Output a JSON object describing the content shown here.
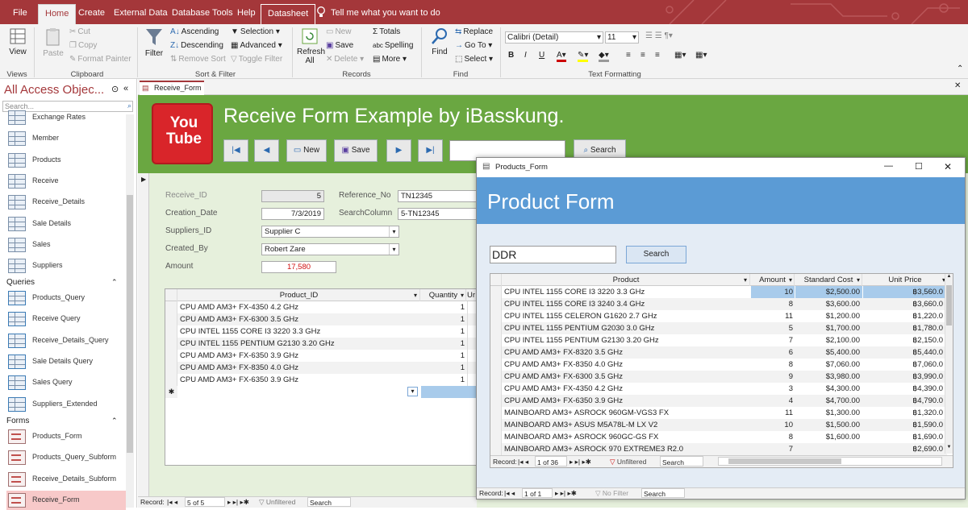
{
  "menubar": {
    "tabs": [
      "File",
      "Home",
      "Create",
      "External Data",
      "Database Tools",
      "Help",
      "Datasheet"
    ],
    "tell_me": "Tell me what you want to do"
  },
  "ribbon": {
    "views": {
      "view": "View",
      "label": "Views"
    },
    "clipboard": {
      "paste": "Paste",
      "cut": "Cut",
      "copy": "Copy",
      "format_painter": "Format Painter",
      "label": "Clipboard"
    },
    "sort_filter": {
      "filter": "Filter",
      "ascending": "Ascending",
      "descending": "Descending",
      "remove_sort": "Remove Sort",
      "selection": "Selection",
      "advanced": "Advanced",
      "toggle_filter": "Toggle Filter",
      "label": "Sort & Filter"
    },
    "records": {
      "refresh": "Refresh",
      "refresh2": "All",
      "new": "New",
      "save": "Save",
      "delete": "Delete",
      "totals": "Totals",
      "spelling": "Spelling",
      "more": "More",
      "label": "Records"
    },
    "find": {
      "find": "Find",
      "replace": "Replace",
      "goto": "Go To",
      "select": "Select",
      "label": "Find"
    },
    "text": {
      "font": "Calibri (Detail)",
      "size": "11",
      "label": "Text Formatting"
    }
  },
  "nav": {
    "title": "All Access Objec...",
    "search_placeholder": "Search...",
    "tables": [
      "Exchange Rates",
      "Member",
      "Products",
      "Receive",
      "Receive_Details",
      "Sale Details",
      "Sales",
      "Suppliers"
    ],
    "queries_header": "Queries",
    "queries": [
      "Products_Query",
      "Receive Query",
      "Receive_Details_Query",
      "Sale Details Query",
      "Sales Query",
      "Suppliers_Extended"
    ],
    "forms_header": "Forms",
    "forms": [
      "Products_Form",
      "Products_Query_Subform",
      "Receive_Details_Subform",
      "Receive_Form"
    ]
  },
  "doc_tab": "Receive_Form",
  "receive_form": {
    "title": "Receive Form Example by iBasskung.",
    "youtube": "You Tube",
    "buttons": {
      "new": "New",
      "save": "Save",
      "search": "Search"
    },
    "labels": {
      "receive_id": "Receive_ID",
      "creation_date": "Creation_Date",
      "suppliers_id": "Suppliers_ID",
      "created_by": "Created_By",
      "amount": "Amount",
      "reference_no": "Reference_No",
      "search_column": "SearchColumn"
    },
    "values": {
      "receive_id": "5",
      "creation_date": "7/3/2019",
      "suppliers_id": "Supplier C",
      "created_by": "Robert Zare",
      "amount": "17,580",
      "reference_no": "TN12345",
      "search_column": "5-TN12345"
    },
    "subgrid": {
      "headers": [
        "Product_ID",
        "Quantity",
        "Ur"
      ],
      "rows": [
        [
          "CPU AMD AM3+ FX-4350 4.2 GHz",
          "1"
        ],
        [
          "CPU AMD AM3+ FX-6300 3.5 GHz",
          "1"
        ],
        [
          "CPU INTEL 1155 CORE I3 3220 3.3 GHz",
          "1"
        ],
        [
          "CPU INTEL 1155 PENTIUM G2130 3.20 GHz",
          "1"
        ],
        [
          "CPU AMD AM3+ FX-6350 3.9 GHz",
          "1"
        ],
        [
          "CPU AMD AM3+ FX-8350 4.0 GHz",
          "1"
        ],
        [
          "CPU AMD AM3+ FX-6350 3.9 GHz",
          "1"
        ]
      ]
    },
    "record_bar": {
      "label": "Record:",
      "pos": "5 of 5",
      "filter": "Unfiltered",
      "search": "Search"
    }
  },
  "product_form": {
    "window_title": "Products_Form",
    "title": "Product Form",
    "search_value": "DDR",
    "search_button": "Search",
    "headers": [
      "Product",
      "Amount",
      "Standard Cost",
      "Unit Price"
    ],
    "rows": [
      [
        "CPU INTEL 1155 CORE I3 3220 3.3 GHz",
        "10",
        "$2,500.00",
        "฿3,560.0"
      ],
      [
        "CPU INTEL 1155 CORE I3 3240 3.4 GHz",
        "8",
        "$3,600.00",
        "฿3,660.0"
      ],
      [
        "CPU INTEL 1155 CELERON G1620 2.7 GHz",
        "11",
        "$1,200.00",
        "฿1,220.0"
      ],
      [
        "CPU INTEL 1155 PENTIUM G2030 3.0 GHz",
        "5",
        "$1,700.00",
        "฿1,780.0"
      ],
      [
        "CPU INTEL 1155 PENTIUM G2130 3.20 GHz",
        "7",
        "$2,100.00",
        "฿2,150.0"
      ],
      [
        "CPU AMD AM3+ FX-8320 3.5 GHz",
        "6",
        "$5,400.00",
        "฿5,440.0"
      ],
      [
        "CPU AMD AM3+ FX-8350 4.0 GHz",
        "8",
        "$7,060.00",
        "฿7,060.0"
      ],
      [
        "CPU AMD AM3+ FX-6300 3.5 GHz",
        "9",
        "$3,980.00",
        "฿3,990.0"
      ],
      [
        "CPU AMD AM3+ FX-4350 4.2 GHz",
        "3",
        "$4,300.00",
        "฿4,390.0"
      ],
      [
        "CPU AMD AM3+ FX-6350 3.9 GHz",
        "4",
        "$4,700.00",
        "฿4,790.0"
      ],
      [
        "MAINBOARD AM3+ ASROCK 960GM-VGS3 FX",
        "11",
        "$1,300.00",
        "฿1,320.0"
      ],
      [
        "MAINBOARD AM3+ ASUS M5A78L-M LX V2",
        "10",
        "$1,500.00",
        "฿1,590.0"
      ],
      [
        "MAINBOARD AM3+ ASROCK 960GC-GS FX",
        "8",
        "$1,600.00",
        "฿1,690.0"
      ],
      [
        "MAINBOARD AM3+ ASROCK 970 EXTREME3 R2.0",
        "7",
        "",
        "฿2,690.0"
      ]
    ],
    "grid_record_bar": {
      "label": "Record:",
      "pos": "1 of 36",
      "filter": "Unfiltered",
      "search": "Search"
    },
    "form_record_bar": {
      "label": "Record:",
      "pos": "1 of 1",
      "filter": "No Filter",
      "search": "Search"
    }
  },
  "colors": {
    "access_red": "#a4373a",
    "form_green": "#6aa741",
    "product_blue": "#5b9bd5",
    "selection": "#a8cbeb"
  }
}
